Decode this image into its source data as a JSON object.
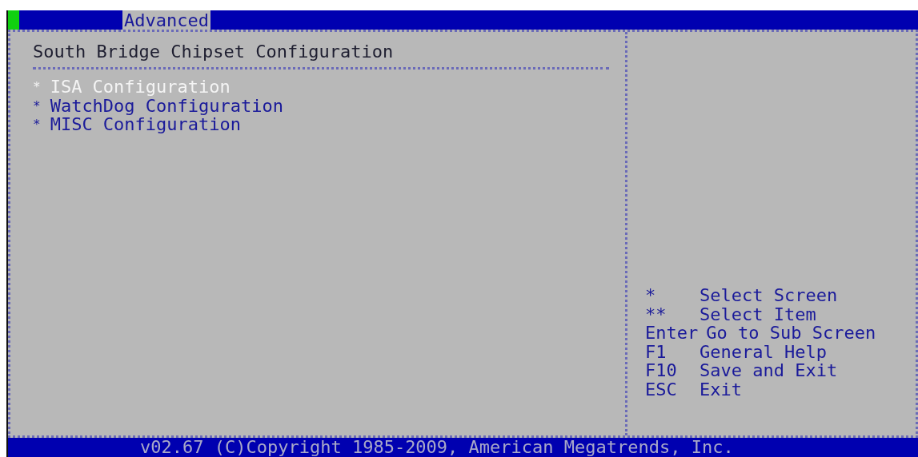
{
  "menu_bar": {
    "tabs": [
      {
        "label": "Advanced",
        "selected": true
      }
    ]
  },
  "panel": {
    "title": "South Bridge Chipset Configuration",
    "items": [
      {
        "marker": "*",
        "label": "ISA Configuration",
        "selected": true
      },
      {
        "marker": "*",
        "label": "WatchDog Configuration",
        "selected": false
      },
      {
        "marker": "*",
        "label": "MISC Configuration",
        "selected": false
      }
    ]
  },
  "help": {
    "keys": [
      {
        "key": "*",
        "action": "Select Screen"
      },
      {
        "key": "**",
        "action": "Select Item"
      },
      {
        "key": "Enter",
        "action": "Go to Sub Screen"
      },
      {
        "key": "F1",
        "action": "General Help"
      },
      {
        "key": "F10",
        "action": "Save and Exit"
      },
      {
        "key": "ESC",
        "action": "Exit"
      }
    ]
  },
  "status_bar": {
    "text": "v02.67 (C)Copyright 1985-2009, American Megatrends, Inc."
  }
}
